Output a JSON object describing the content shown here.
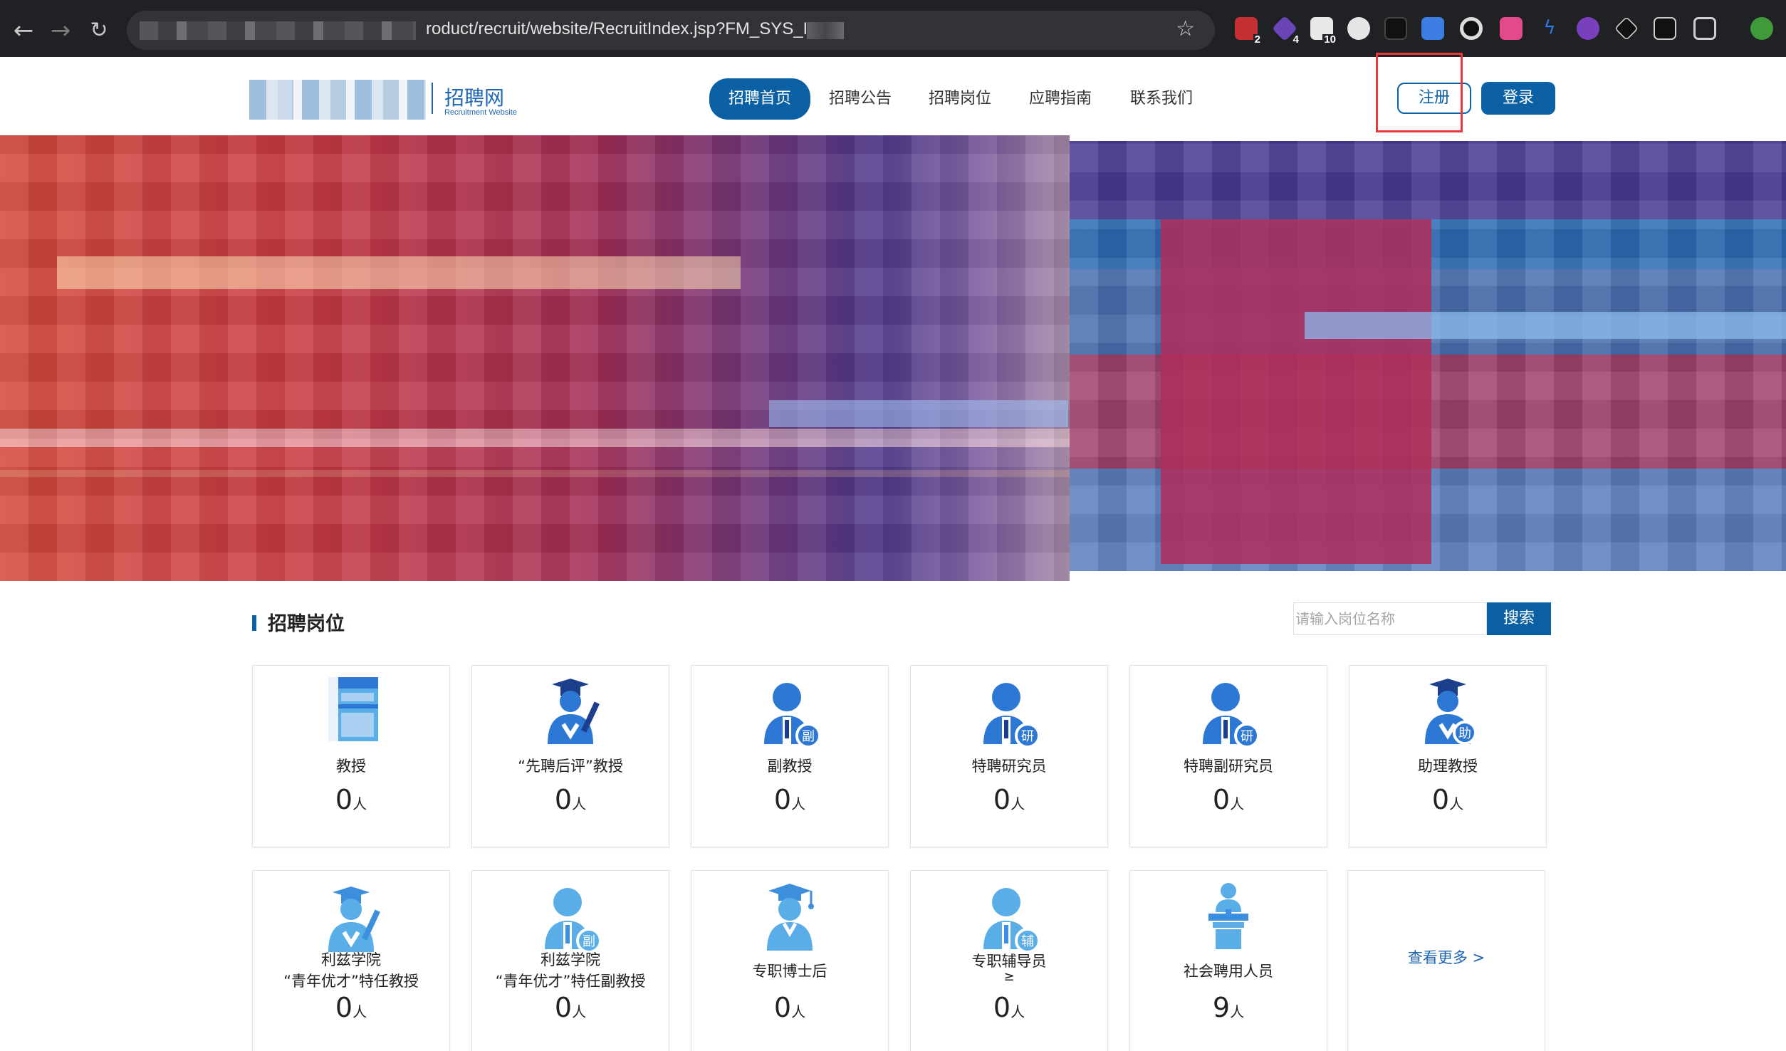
{
  "browser": {
    "url_visible": "roduct/recruit/website/RecruitIndex.jsp?FM_SYS_ID=",
    "extension_badges": [
      "2",
      "4",
      "10"
    ]
  },
  "site": {
    "logo_title": "招聘网",
    "logo_subtitle": "Recruitment Website"
  },
  "nav": {
    "items": [
      {
        "label": "招聘首页",
        "active": true
      },
      {
        "label": "招聘公告",
        "active": false
      },
      {
        "label": "招聘岗位",
        "active": false
      },
      {
        "label": "应聘指南",
        "active": false
      },
      {
        "label": "联系我们",
        "active": false
      }
    ],
    "register_label": "注册",
    "login_label": "登录"
  },
  "section": {
    "title": "招聘岗位",
    "search_placeholder": "请输入岗位名称",
    "search_button": "搜索"
  },
  "positions": [
    {
      "label": "教授",
      "count": "0",
      "unit": "人",
      "icon": "book-icon"
    },
    {
      "label": "“先聘后评”教授",
      "count": "0",
      "unit": "人",
      "icon": "graduate-icon"
    },
    {
      "label": "副教授",
      "count": "0",
      "unit": "人",
      "icon": "person-badge-fu-icon",
      "badge": "副"
    },
    {
      "label": "特聘研究员",
      "count": "0",
      "unit": "人",
      "icon": "person-badge-yan-icon",
      "badge": "研"
    },
    {
      "label": "特聘副研究员",
      "count": "0",
      "unit": "人",
      "icon": "person-badge-yan-icon",
      "badge": "研"
    },
    {
      "label": "助理教授",
      "count": "0",
      "unit": "人",
      "icon": "graduate-badge-zhu-icon",
      "badge": "助"
    },
    {
      "label_lines": [
        "利兹学院",
        "“青年优才”特任教授"
      ],
      "count": "0",
      "unit": "人",
      "icon": "graduate-icon"
    },
    {
      "label_lines": [
        "利兹学院",
        "“青年优才”特任副教授"
      ],
      "count": "0",
      "unit": "人",
      "icon": "person-badge-fu-icon",
      "badge": "副"
    },
    {
      "label": "专职博士后",
      "count": "0",
      "unit": "人",
      "icon": "doctor-cap-icon"
    },
    {
      "label_lines": [
        "专职辅导员",
        "≥"
      ],
      "count": "0",
      "unit": "人",
      "icon": "person-badge-fu2-icon",
      "badge": "辅"
    },
    {
      "label": "社会聘用人员",
      "count": "9",
      "unit": "人",
      "icon": "speaker-podium-icon"
    }
  ],
  "more_link": "查看更多 >",
  "colors": {
    "primary": "#0b61a4",
    "icon_blue": "#2c78d4",
    "icon_light": "#5aaee8",
    "highlight": "#e5393c"
  }
}
